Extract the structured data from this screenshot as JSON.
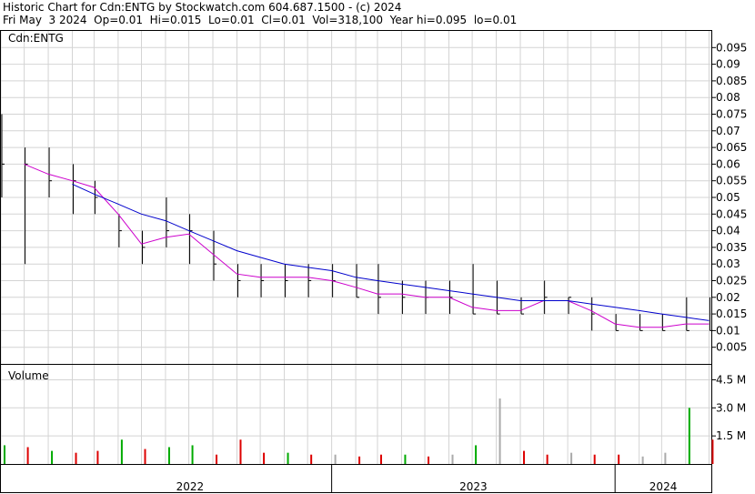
{
  "header": {
    "line1": "Historic Chart for Cdn:ENTG by Stockwatch.com 604.687.1500 - (c) 2024",
    "line2": "Fri May  3 2024  Op=0.01  Hi=0.015  Lo=0.01  Cl=0.01  Vol=318,100  Year hi=0.095  lo=0.01"
  },
  "colors": {
    "price": "#000000",
    "ma_short": "#cc00cc",
    "ma_long": "#0000cc",
    "vol_up": "#00aa00",
    "vol_down": "#dd0000",
    "vol_flat": "#aaaaaa",
    "grid": "#d4d4d4"
  },
  "chart_data": [
    {
      "type": "line",
      "panel": "price",
      "title": "Cdn:ENTG",
      "y_ticks": [
        "0.095",
        "0.09",
        "0.085",
        "0.08",
        "0.075",
        "0.07",
        "0.065",
        "0.06",
        "0.055",
        "0.05",
        "0.045",
        "0.04",
        "0.035",
        "0.03",
        "0.025",
        "0.02",
        "0.015",
        "0.01",
        "0.005"
      ],
      "ylim": [
        0,
        0.1
      ],
      "x_labels": [
        "2022",
        "2023",
        "2024"
      ],
      "grid": true,
      "series": [
        {
          "style": "bars",
          "x": [
            "2021-11",
            "2021-12",
            "2022-01",
            "2022-02",
            "2022-03",
            "2022-04",
            "2022-05",
            "2022-06",
            "2022-07",
            "2022-08",
            "2022-09",
            "2022-10",
            "2022-11",
            "2022-12",
            "2023-01",
            "2023-02",
            "2023-03",
            "2023-04",
            "2023-05",
            "2023-06",
            "2023-07",
            "2023-08",
            "2023-09",
            "2023-10",
            "2023-11",
            "2023-12",
            "2024-01",
            "2024-02",
            "2024-03",
            "2024-04",
            "2024-05"
          ],
          "close": [
            0.06,
            0.06,
            0.055,
            0.055,
            0.05,
            0.04,
            0.035,
            0.04,
            0.04,
            0.03,
            0.025,
            0.025,
            0.025,
            0.025,
            0.025,
            0.02,
            0.02,
            0.02,
            0.02,
            0.02,
            0.015,
            0.015,
            0.015,
            0.02,
            0.02,
            0.015,
            0.01,
            0.01,
            0.01,
            0.01,
            0.01
          ],
          "high": [
            0.075,
            0.065,
            0.065,
            0.06,
            0.055,
            0.045,
            0.04,
            0.05,
            0.045,
            0.04,
            0.03,
            0.03,
            0.03,
            0.03,
            0.03,
            0.03,
            0.03,
            0.025,
            0.025,
            0.025,
            0.03,
            0.025,
            0.02,
            0.025,
            0.02,
            0.02,
            0.015,
            0.015,
            0.015,
            0.02,
            0.02
          ],
          "low": [
            0.05,
            0.03,
            0.05,
            0.045,
            0.045,
            0.035,
            0.03,
            0.035,
            0.03,
            0.025,
            0.02,
            0.02,
            0.02,
            0.02,
            0.02,
            0.02,
            0.015,
            0.015,
            0.015,
            0.015,
            0.015,
            0.015,
            0.015,
            0.015,
            0.015,
            0.01,
            0.01,
            0.01,
            0.01,
            0.01,
            0.01
          ]
        },
        {
          "style": "line",
          "x": [
            "2021-11",
            "2021-12",
            "2022-01",
            "2022-02",
            "2022-03",
            "2022-04",
            "2022-05",
            "2022-06",
            "2022-07",
            "2022-08",
            "2022-09",
            "2022-10",
            "2022-11",
            "2022-12",
            "2023-01",
            "2023-02",
            "2023-03",
            "2023-04",
            "2023-05",
            "2023-06",
            "2023-07",
            "2023-08",
            "2023-09",
            "2023-10",
            "2023-11",
            "2023-12",
            "2024-01",
            "2024-02",
            "2024-03",
            "2024-04",
            "2024-05"
          ],
          "values": [
            null,
            0.06,
            0.057,
            0.055,
            0.053,
            0.045,
            0.036,
            0.038,
            0.039,
            0.033,
            0.027,
            0.026,
            0.026,
            0.026,
            0.025,
            0.023,
            0.021,
            0.021,
            0.02,
            0.02,
            0.017,
            0.016,
            0.016,
            0.019,
            0.019,
            0.016,
            0.012,
            0.011,
            0.011,
            0.012,
            0.012
          ]
        },
        {
          "style": "line",
          "x": [
            "2022-02",
            "2022-03",
            "2022-04",
            "2022-05",
            "2022-06",
            "2022-07",
            "2022-08",
            "2022-09",
            "2022-10",
            "2022-11",
            "2022-12",
            "2023-01",
            "2023-02",
            "2023-03",
            "2023-04",
            "2023-05",
            "2023-06",
            "2023-07",
            "2023-08",
            "2023-09",
            "2023-10",
            "2023-11",
            "2023-12",
            "2024-01",
            "2024-02",
            "2024-03",
            "2024-04",
            "2024-05"
          ],
          "values": [
            0.054,
            0.051,
            0.048,
            0.045,
            0.043,
            0.04,
            0.037,
            0.034,
            0.032,
            0.03,
            0.029,
            0.028,
            0.026,
            0.025,
            0.024,
            0.023,
            0.022,
            0.021,
            0.02,
            0.019,
            0.019,
            0.019,
            0.018,
            0.017,
            0.016,
            0.015,
            0.014,
            0.013
          ]
        }
      ]
    },
    {
      "type": "bar",
      "panel": "volume",
      "title": "Volume",
      "y_ticks": [
        "4.5 M",
        "3.0 M",
        "1.5 M"
      ],
      "ylim": [
        0,
        5.3
      ],
      "x": [
        "2021-11",
        "2021-12",
        "2022-01",
        "2022-02",
        "2022-03",
        "2022-04",
        "2022-05",
        "2022-06",
        "2022-07",
        "2022-08",
        "2022-09",
        "2022-10",
        "2022-11",
        "2022-12",
        "2023-01",
        "2023-02",
        "2023-03",
        "2023-04",
        "2023-05",
        "2023-06",
        "2023-07",
        "2023-08",
        "2023-09",
        "2023-10",
        "2023-11",
        "2023-12",
        "2024-01",
        "2024-02",
        "2024-03",
        "2024-04",
        "2024-05"
      ],
      "values": [
        1.0,
        0.9,
        0.7,
        0.6,
        0.7,
        1.3,
        0.8,
        0.9,
        1.0,
        0.5,
        1.3,
        0.6,
        0.6,
        0.5,
        0.5,
        0.4,
        0.5,
        0.5,
        0.4,
        0.5,
        1.0,
        3.5,
        0.7,
        0.5,
        0.6,
        0.5,
        0.5,
        0.4,
        0.6,
        3.0,
        1.3
      ],
      "direction": [
        "up",
        "down",
        "up",
        "down",
        "down",
        "up",
        "down",
        "up",
        "up",
        "down",
        "down",
        "down",
        "up",
        "down",
        "flat",
        "down",
        "down",
        "up",
        "down",
        "flat",
        "up",
        "flat",
        "down",
        "down",
        "flat",
        "down",
        "down",
        "flat",
        "flat",
        "up",
        "down"
      ]
    }
  ]
}
